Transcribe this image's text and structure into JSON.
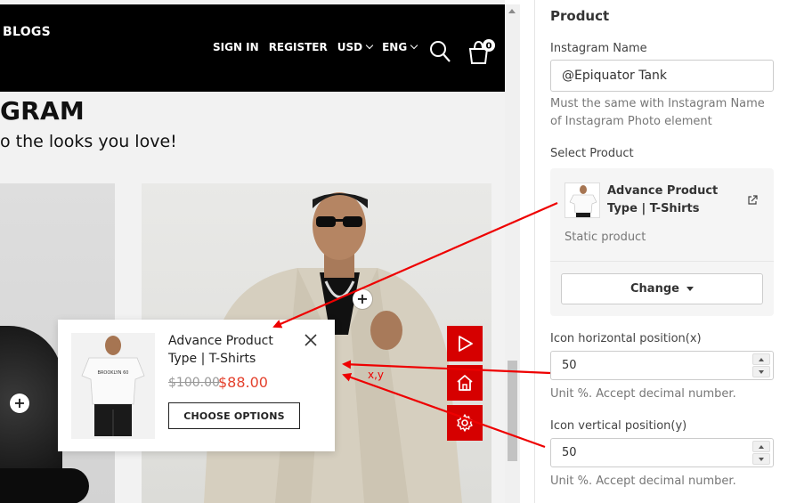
{
  "store": {
    "nav_blogs": "BLOGS",
    "nav_items": [
      {
        "label": "SIGN IN",
        "dropdown": false
      },
      {
        "label": "REGISTER",
        "dropdown": false
      },
      {
        "label": "USD",
        "dropdown": true
      },
      {
        "label": "ENG",
        "dropdown": true
      }
    ],
    "cart_count": "0",
    "section_title": "GRAM",
    "section_subtitle": "o the looks you love!",
    "hotspot_symbol": "+"
  },
  "popup": {
    "title": "Advance Product Type | T-Shirts",
    "old_price": "$100.00",
    "new_price": "$88.00",
    "choose_label": "CHOOSE OPTIONS",
    "shirt_text": "BROOKLYN 60"
  },
  "annotation": {
    "xy_label": "x,y",
    "color": "#ee0000"
  },
  "tools": {
    "accent": "#d60000",
    "icons": [
      "play-icon",
      "home-icon",
      "gear-icon"
    ]
  },
  "panel": {
    "heading": "Product",
    "instagram_label": "Instagram Name",
    "instagram_value": "@Epiquator Tank",
    "instagram_help": "Must the same with Instagram Name of Instagram Photo element",
    "select_label": "Select Product",
    "product_title": "Advance Product Type | T-Shirts",
    "product_static": "Static product",
    "change_label": "Change",
    "h_label": "Icon horizontal position(x)",
    "h_value": "50",
    "h_help": "Unit %. Accept decimal number.",
    "v_label": "Icon vertical position(y)",
    "v_value": "50",
    "v_help": "Unit %. Accept decimal number."
  }
}
